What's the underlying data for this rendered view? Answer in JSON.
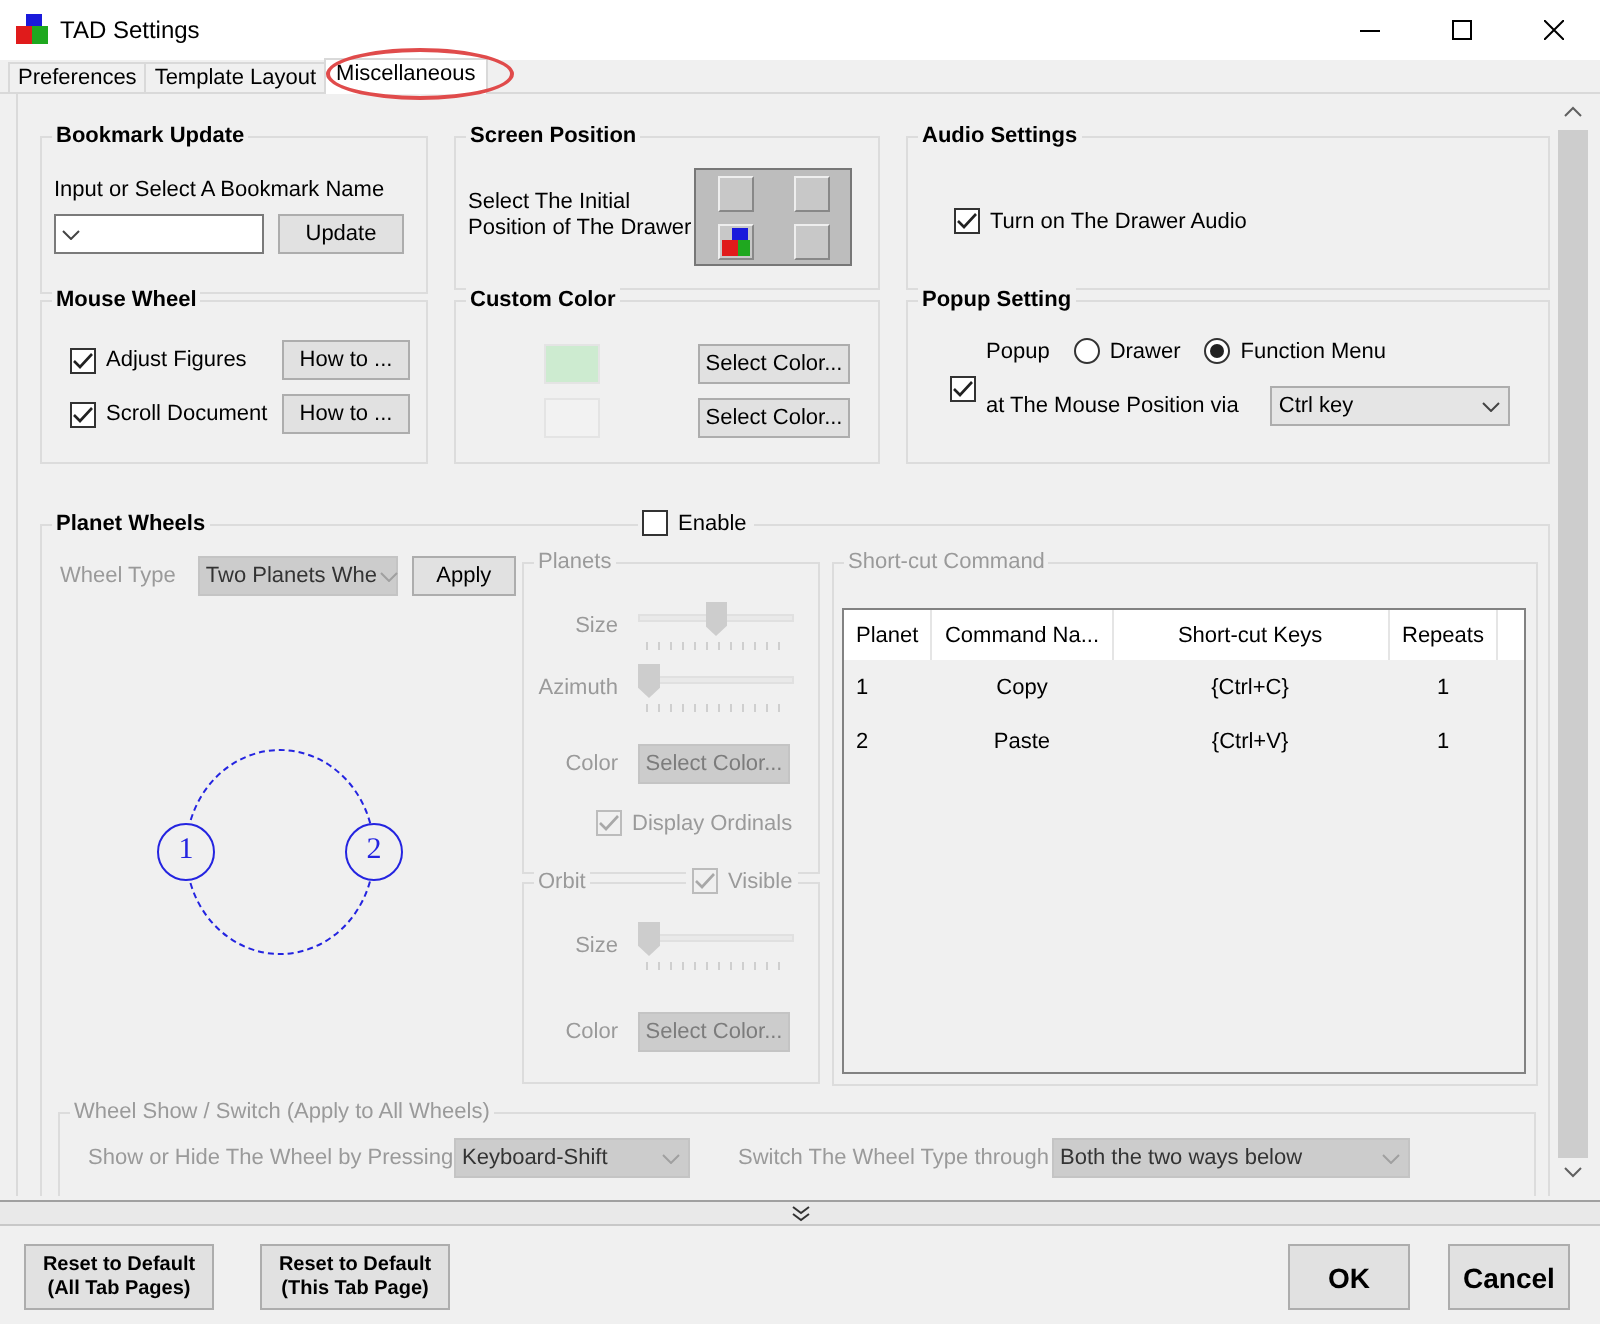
{
  "window": {
    "title": "TAD Settings"
  },
  "tabs": [
    {
      "label": "Preferences",
      "selected": false,
      "highlighted": false
    },
    {
      "label": "Template Layout",
      "selected": false,
      "highlighted": false
    },
    {
      "label": "Miscellaneous",
      "selected": true,
      "highlighted": true
    }
  ],
  "bookmark_update": {
    "title": "Bookmark Update",
    "label": "Input or Select A Bookmark Name",
    "button": "Update"
  },
  "screen_position": {
    "title": "Screen Position",
    "label": "Select The Initial Position of The Drawer",
    "corners": [
      {
        "selected": false
      },
      {
        "selected": false
      },
      {
        "selected": true
      },
      {
        "selected": false
      }
    ]
  },
  "audio_settings": {
    "title": "Audio Settings",
    "checkbox": {
      "label": "Turn on The Drawer Audio",
      "checked": true
    }
  },
  "mouse_wheel": {
    "title": "Mouse Wheel",
    "items": [
      {
        "label": "Adjust Figures",
        "checked": true,
        "button": "How to ..."
      },
      {
        "label": "Scroll Document",
        "checked": true,
        "button": "How to ..."
      }
    ]
  },
  "custom_color": {
    "title": "Custom Color",
    "items": [
      {
        "color": "#cdebd0",
        "button": "Select Color..."
      },
      {
        "color": "#f2f2f2",
        "button": "Select Color..."
      }
    ]
  },
  "popup_setting": {
    "title": "Popup Setting",
    "checked": true,
    "popup_label": "Popup",
    "options": [
      {
        "label": "Drawer",
        "selected": false
      },
      {
        "label": "Function Menu",
        "selected": true
      }
    ],
    "via_label": "at The Mouse Position via",
    "via_value": "Ctrl key"
  },
  "planet_wheels": {
    "title": "Planet Wheels",
    "enable": {
      "label": "Enable",
      "checked": false
    },
    "wheel_type_label": "Wheel Type",
    "wheel_type_value": "Two Planets Whe",
    "apply": "Apply",
    "diagram": {
      "planets": [
        "1",
        "2"
      ]
    },
    "planets": {
      "title": "Planets",
      "size_label": "Size",
      "size": {
        "level": 0.5
      },
      "azimuth_label": "Azimuth",
      "azimuth": {
        "level": 0
      },
      "color_label": "Color",
      "color_button": "Select Color...",
      "ordinals": {
        "label": "Display Ordinals",
        "checked": true
      }
    },
    "orbit": {
      "title": "Orbit",
      "visible": {
        "label": "Visible",
        "checked": true
      },
      "size_label": "Size",
      "size": {
        "level": 0
      },
      "color_label": "Color",
      "color_button": "Select Color..."
    },
    "shortcut": {
      "title": "Short-cut Command",
      "columns": [
        "Planet",
        "Command Na...",
        "Short-cut Keys",
        "Repeats"
      ],
      "rows": [
        [
          "1",
          "Copy",
          "{Ctrl+C}",
          "1"
        ],
        [
          "2",
          "Paste",
          "{Ctrl+V}",
          "1"
        ]
      ]
    },
    "wheel_show": {
      "title": "Wheel Show / Switch (Apply to All Wheels)",
      "show_label": "Show or Hide The Wheel by Pressing",
      "show_value": "Keyboard-Shift",
      "switch_label": "Switch The Wheel Type through",
      "switch_value": "Both the two ways below"
    }
  },
  "footer": {
    "reset_buttons": [
      "Reset to Default\n(All Tab Pages)",
      "Reset to Default\n(This Tab Page)"
    ],
    "ok": "OK",
    "cancel": "Cancel"
  }
}
